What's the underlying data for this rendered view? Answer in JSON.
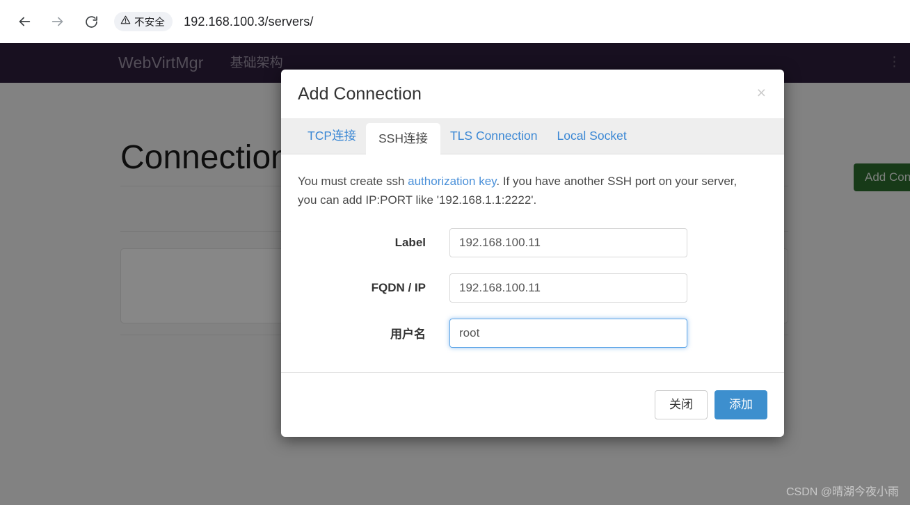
{
  "browser": {
    "back_icon": "arrow-left-icon",
    "forward_icon": "arrow-right-icon",
    "reload_icon": "reload-icon",
    "security_icon": "warning-triangle-icon",
    "security_label": "不安全",
    "url": "192.168.100.3/servers/"
  },
  "site": {
    "navbar": {
      "brand": "WebVirtMgr",
      "links": [
        {
          "label": "基础架构"
        }
      ],
      "menu_dots": "⋮",
      "bg_color": "#2e1f3e"
    },
    "page_title": "Connections",
    "add_connection_button": "Add Conn",
    "add_connection_color": "#2c6e2f"
  },
  "modal": {
    "title": "Add Connection",
    "close_icon": "×",
    "tabs": [
      {
        "label": "TCP连接",
        "active": false
      },
      {
        "label": "SSH连接",
        "active": true
      },
      {
        "label": "TLS Connection",
        "active": false
      },
      {
        "label": "Local Socket",
        "active": false
      }
    ],
    "help": {
      "before_link": "You must create ssh ",
      "link": "authorization key",
      "after_link": ". If you have another SSH port on your server, you can add IP:PORT like '192.168.1.1:2222'."
    },
    "fields": [
      {
        "label": "Label",
        "value": "192.168.100.11",
        "focused": false
      },
      {
        "label": "FQDN / IP",
        "value": "192.168.100.11",
        "focused": false
      },
      {
        "label": "用户名",
        "value": "root",
        "focused": true
      }
    ],
    "buttons": {
      "close": "关闭",
      "submit": "添加",
      "submit_color": "#3d8fce"
    }
  },
  "watermark": "CSDN @晴湖今夜小雨"
}
